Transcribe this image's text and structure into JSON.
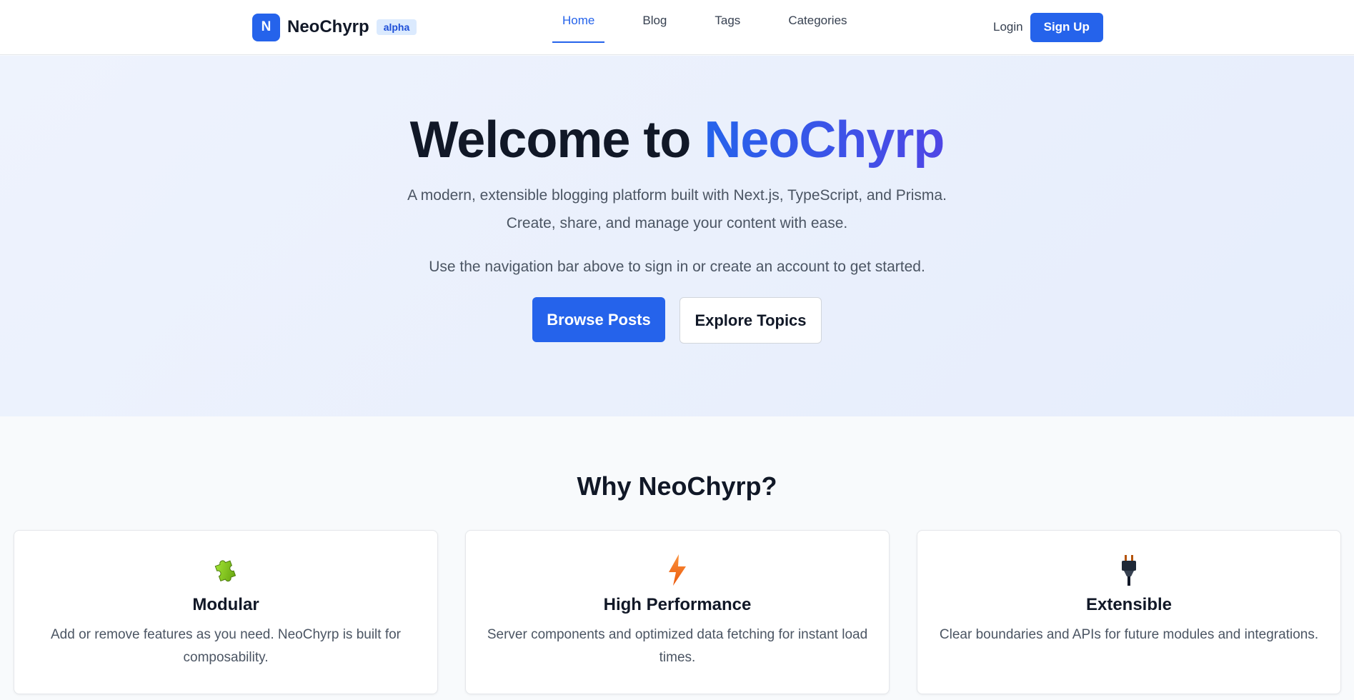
{
  "nav": {
    "brand_initial": "N",
    "brand_name": "NeoChyrp",
    "badge": "alpha",
    "links": [
      {
        "label": "Home",
        "active": true
      },
      {
        "label": "Blog"
      },
      {
        "label": "Tags"
      },
      {
        "label": "Categories"
      }
    ],
    "login": "Login",
    "signup": "Sign Up"
  },
  "hero": {
    "title_prefix": "Welcome to ",
    "title_accent": "NeoChyrp",
    "subtitle_line1": "A modern, extensible blogging platform built with Next.js, TypeScript, and Prisma.",
    "subtitle_line2": "Create, share, and manage your content with ease.",
    "note": "Use the navigation bar above to sign in or create an account to get started.",
    "primary_button": "Browse Posts",
    "secondary_button": "Explore Topics"
  },
  "features": {
    "heading": "Why NeoChyrp?",
    "cards": [
      {
        "icon": "puzzle-icon",
        "title": "Modular",
        "text": "Add or remove features as you need. NeoChyrp is built for composability."
      },
      {
        "icon": "lightning-icon",
        "title": "High Performance",
        "text": "Server components and optimized data fetching for instant load times."
      },
      {
        "icon": "plug-icon",
        "title": "Extensible",
        "text": "Clear boundaries and APIs for future modules and integrations."
      }
    ]
  },
  "colors": {
    "primary": "#2563eb",
    "accent_end": "#4f46e5",
    "badge_bg": "#dbeafe"
  }
}
